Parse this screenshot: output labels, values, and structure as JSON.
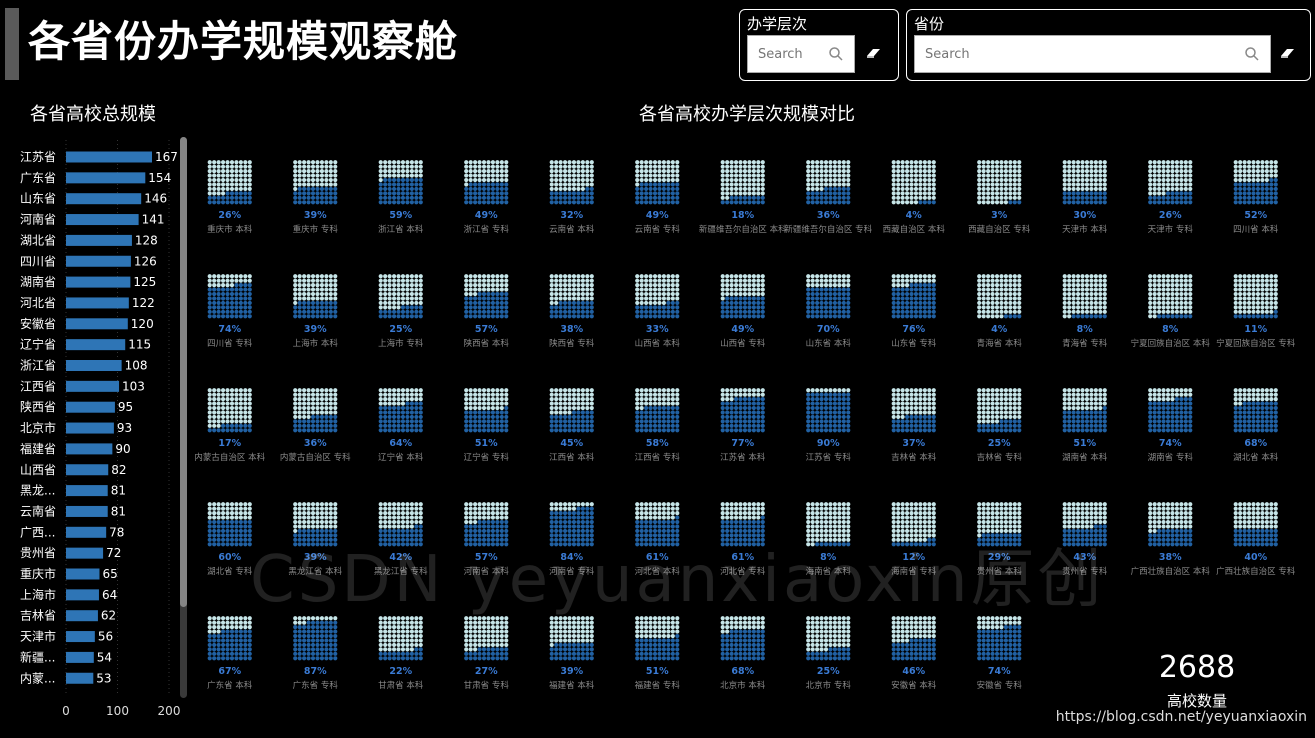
{
  "title": "各省份办学规模观察舱",
  "filters": [
    {
      "label": "办学层次",
      "placeholder": "Search"
    },
    {
      "label": "省份",
      "placeholder": "Search"
    }
  ],
  "bar_section_title": "各省高校总规模",
  "waffle_section_title": "各省高校办学层次规模对比",
  "kpi": {
    "value": "2688",
    "label": "高校数量"
  },
  "watermark": "CSDN yeyuanxiaoxin原创",
  "source_url": "https://blog.csdn.net/yeyuanxiaoxin",
  "colors": {
    "bar": "#2e75b6",
    "dot_fill": "#2161a3",
    "dot_empty": "#c6e5e8",
    "pct_text": "#3a7bd5",
    "label_text": "#8a8a8a"
  },
  "chart_data": [
    {
      "type": "bar",
      "orientation": "horizontal",
      "title": "各省高校总规模",
      "categories": [
        "江苏省",
        "广东省",
        "山东省",
        "河南省",
        "湖北省",
        "四川省",
        "湖南省",
        "河北省",
        "安徽省",
        "辽宁省",
        "浙江省",
        "江西省",
        "陕西省",
        "北京市",
        "福建省",
        "山西省",
        "黑龙...",
        "云南省",
        "广西...",
        "贵州省",
        "重庆市",
        "上海市",
        "吉林省",
        "天津市",
        "新疆...",
        "内蒙..."
      ],
      "values": [
        167,
        154,
        146,
        141,
        128,
        126,
        125,
        122,
        120,
        115,
        108,
        103,
        95,
        93,
        90,
        82,
        81,
        81,
        78,
        72,
        65,
        64,
        62,
        56,
        54,
        53
      ],
      "xlim": [
        0,
        200
      ],
      "xticks": [
        0,
        100,
        200
      ]
    },
    {
      "type": "waffle",
      "title": "各省高校办学层次规模对比",
      "items": [
        {
          "label": "重庆市 本科",
          "percent": 26
        },
        {
          "label": "重庆市 专科",
          "percent": 39
        },
        {
          "label": "浙江省 本科",
          "percent": 59
        },
        {
          "label": "浙江省 专科",
          "percent": 49
        },
        {
          "label": "云南省 本科",
          "percent": 32
        },
        {
          "label": "云南省 专科",
          "percent": 49
        },
        {
          "label": "新疆维吾尔自治区 本科",
          "percent": 18
        },
        {
          "label": "新疆维吾尔自治区 专科",
          "percent": 36
        },
        {
          "label": "西藏自治区 本科",
          "percent": 4
        },
        {
          "label": "西藏自治区 专科",
          "percent": 3
        },
        {
          "label": "天津市 本科",
          "percent": 30
        },
        {
          "label": "天津市 专科",
          "percent": 26
        },
        {
          "label": "四川省 本科",
          "percent": 52
        },
        {
          "label": "四川省 专科",
          "percent": 74
        },
        {
          "label": "上海市 本科",
          "percent": 39
        },
        {
          "label": "上海市 专科",
          "percent": 25
        },
        {
          "label": "陕西省 本科",
          "percent": 57
        },
        {
          "label": "陕西省 专科",
          "percent": 38
        },
        {
          "label": "山西省 本科",
          "percent": 33
        },
        {
          "label": "山西省 专科",
          "percent": 49
        },
        {
          "label": "山东省 本科",
          "percent": 70
        },
        {
          "label": "山东省 专科",
          "percent": 76
        },
        {
          "label": "青海省 本科",
          "percent": 4
        },
        {
          "label": "青海省 专科",
          "percent": 8
        },
        {
          "label": "宁夏回族自治区 本科",
          "percent": 8
        },
        {
          "label": "宁夏回族自治区 专科",
          "percent": 11
        },
        {
          "label": "内蒙古自治区 本科",
          "percent": 17
        },
        {
          "label": "内蒙古自治区 专科",
          "percent": 36
        },
        {
          "label": "辽宁省 本科",
          "percent": 64
        },
        {
          "label": "辽宁省 专科",
          "percent": 51
        },
        {
          "label": "江西省 本科",
          "percent": 45
        },
        {
          "label": "江西省 专科",
          "percent": 58
        },
        {
          "label": "江苏省 本科",
          "percent": 77
        },
        {
          "label": "江苏省 专科",
          "percent": 90
        },
        {
          "label": "吉林省 本科",
          "percent": 37
        },
        {
          "label": "吉林省 专科",
          "percent": 25
        },
        {
          "label": "湖南省 本科",
          "percent": 51
        },
        {
          "label": "湖南省 专科",
          "percent": 74
        },
        {
          "label": "湖北省 本科",
          "percent": 68
        },
        {
          "label": "湖北省 专科",
          "percent": 60
        },
        {
          "label": "黑龙江省 本科",
          "percent": 39
        },
        {
          "label": "黑龙江省 专科",
          "percent": 42
        },
        {
          "label": "河南省 本科",
          "percent": 57
        },
        {
          "label": "河南省 专科",
          "percent": 84
        },
        {
          "label": "河北省 本科",
          "percent": 61
        },
        {
          "label": "河北省 专科",
          "percent": 61
        },
        {
          "label": "海南省 本科",
          "percent": 8
        },
        {
          "label": "海南省 专科",
          "percent": 12
        },
        {
          "label": "贵州省 本科",
          "percent": 29
        },
        {
          "label": "贵州省 专科",
          "percent": 43
        },
        {
          "label": "广西壮族自治区 本科",
          "percent": 38
        },
        {
          "label": "广西壮族自治区 专科",
          "percent": 40
        },
        {
          "label": "广东省 本科",
          "percent": 67
        },
        {
          "label": "广东省 专科",
          "percent": 87
        },
        {
          "label": "甘肃省 本科",
          "percent": 22
        },
        {
          "label": "甘肃省 专科",
          "percent": 27
        },
        {
          "label": "福建省 本科",
          "percent": 39
        },
        {
          "label": "福建省 专科",
          "percent": 51
        },
        {
          "label": "北京市 本科",
          "percent": 68
        },
        {
          "label": "北京市 专科",
          "percent": 25
        },
        {
          "label": "安徽省 本科",
          "percent": 46
        },
        {
          "label": "安徽省 专科",
          "percent": 74
        }
      ]
    }
  ]
}
